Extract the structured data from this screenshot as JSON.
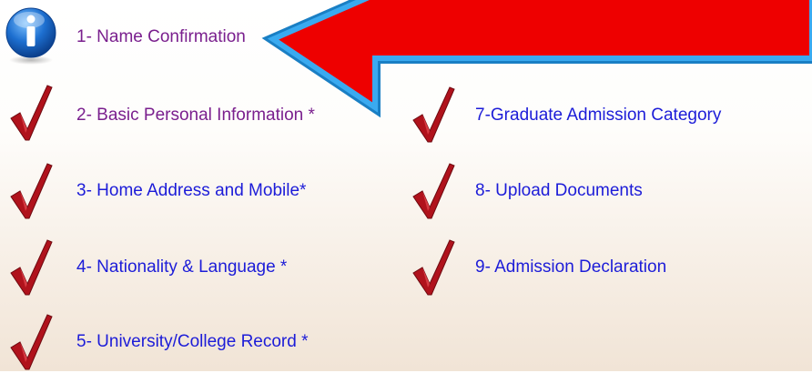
{
  "steps": [
    {
      "label": "1- Name Confirmation",
      "status": "info",
      "visited": true
    },
    {
      "label": "2- Basic Personal Information *",
      "status": "complete",
      "visited": true
    },
    {
      "label": "3- Home Address and Mobile*",
      "status": "complete",
      "visited": false
    },
    {
      "label": "4- Nationality & Language *",
      "status": "complete",
      "visited": false
    },
    {
      "label": "5- University/College Record *",
      "status": "complete",
      "visited": false
    },
    {
      "label": "7-Graduate Admission Category",
      "status": "complete",
      "visited": false
    },
    {
      "label": "8- Upload Documents",
      "status": "complete",
      "visited": false
    },
    {
      "label": "9- Admission Declaration",
      "status": "complete",
      "visited": false
    }
  ],
  "callout": {
    "fill_color": "#ee0000",
    "border_color": "#2e9be0",
    "icon": "left-arrow-callout"
  },
  "colors": {
    "visited_link": "#7a1f8e",
    "unvisited_link": "#1c1cd8",
    "check": "#b0121c",
    "info_blue": "#1d6fd0"
  }
}
